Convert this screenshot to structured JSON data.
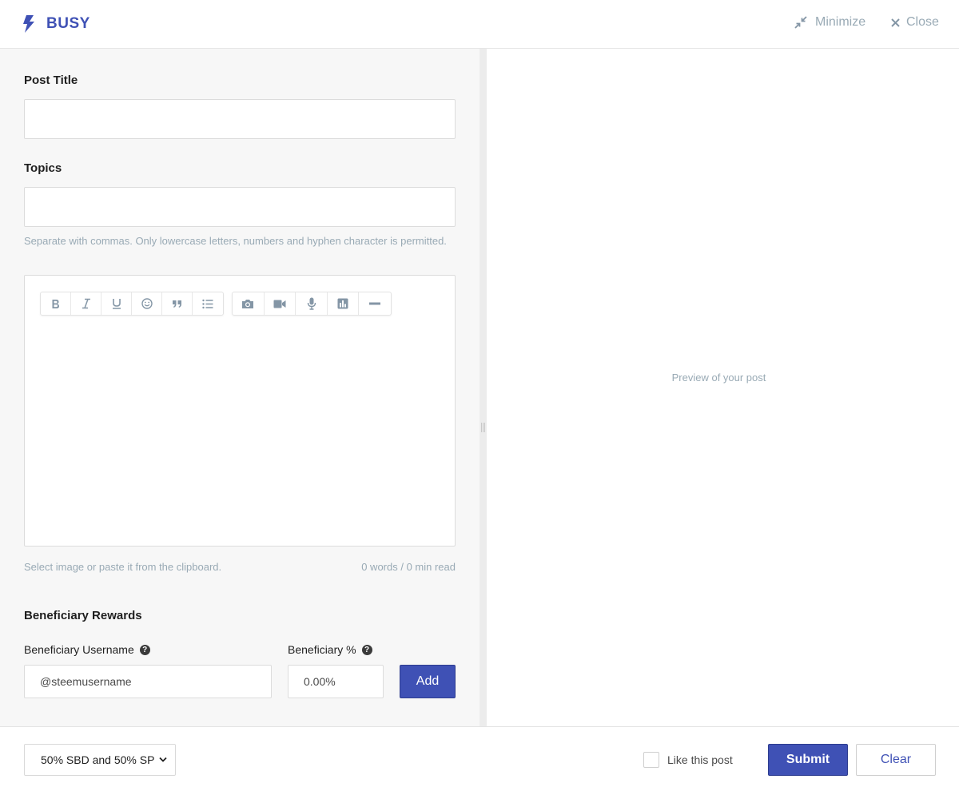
{
  "header": {
    "brand": "BUSY",
    "minimize_label": "Minimize",
    "close_label": "Close",
    "accent_color": "#3f51b5"
  },
  "editor": {
    "title_label": "Post Title",
    "title_value": "",
    "topics_label": "Topics",
    "topics_value": "",
    "topics_hint": "Separate with commas. Only lowercase letters, numbers and hyphen character is permitted.",
    "body_value": "",
    "toolbar": {
      "format_group": [
        "bold-icon",
        "italic-icon",
        "underline-icon",
        "emoji-icon",
        "quote-icon",
        "list-icon"
      ],
      "insert_group": [
        "camera-icon",
        "video-icon",
        "microphone-icon",
        "chart-icon",
        "horizontal-rule-icon"
      ]
    },
    "image_hint": "Select image or paste it from the clipboard.",
    "word_count": "0 words / 0 min read"
  },
  "beneficiary": {
    "heading": "Beneficiary Rewards",
    "username_label": "Beneficiary Username",
    "username_value": "@steemusername",
    "percent_label": "Beneficiary %",
    "percent_value": "0.00%",
    "add_label": "Add"
  },
  "preview": {
    "placeholder": "Preview of your post"
  },
  "footer": {
    "reward_option": "50% SBD and 50% SP",
    "like_label": "Like this post",
    "like_checked": false,
    "submit_label": "Submit",
    "clear_label": "Clear"
  }
}
